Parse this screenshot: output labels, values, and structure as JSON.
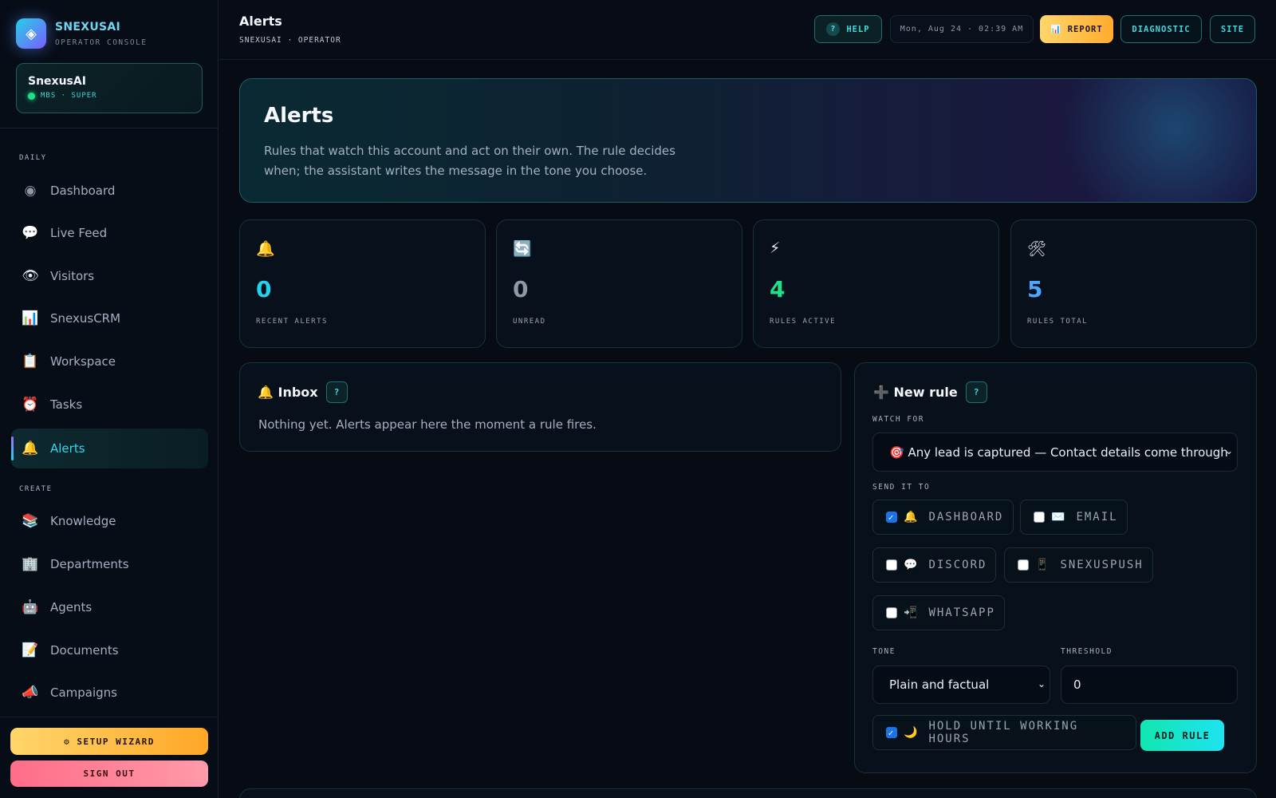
{
  "brand": {
    "name": "SNEXUSAI",
    "subtitle": "OPERATOR CONSOLE",
    "logo_icon": "◈"
  },
  "account": {
    "name": "SnexusAI",
    "plan": "MBS · SUPER",
    "status_color": "#1fe08a"
  },
  "sidebar": {
    "sections": [
      {
        "label": "DAILY"
      },
      {
        "label": "CREATE"
      }
    ],
    "items": [
      {
        "icon": "◉",
        "icon_name": "dashboard-icon",
        "label": "Dashboard"
      },
      {
        "icon": "💬",
        "icon_name": "speech-bubble-icon",
        "label": "Live Feed"
      },
      {
        "icon": "👁",
        "icon_name": "eye-icon",
        "label": "Visitors"
      },
      {
        "icon": "📊",
        "icon_name": "bar-chart-icon",
        "label": "SnexusCRM"
      },
      {
        "icon": "📋",
        "icon_name": "clipboard-icon",
        "label": "Workspace"
      },
      {
        "icon": "⏰",
        "icon_name": "alarm-clock-icon",
        "label": "Tasks"
      },
      {
        "icon": "🔔",
        "icon_name": "bell-icon",
        "label": "Alerts",
        "active": true
      },
      {
        "icon": "📚",
        "icon_name": "books-icon",
        "label": "Knowledge"
      },
      {
        "icon": "🏢",
        "icon_name": "office-building-icon",
        "label": "Departments"
      },
      {
        "icon": "🤖",
        "icon_name": "robot-icon",
        "label": "Agents"
      },
      {
        "icon": "📝",
        "icon_name": "memo-icon",
        "label": "Documents"
      },
      {
        "icon": "📣",
        "icon_name": "megaphone-icon",
        "label": "Campaigns"
      }
    ],
    "setup_wizard": "⚙ SETUP WIZARD",
    "sign_out": "SIGN OUT"
  },
  "topbar": {
    "title": "Alerts",
    "breadcrumb": "SNEXUSAI · OPERATOR",
    "help_label": "HELP",
    "help_icon": "?",
    "clock": "Mon, Aug 24 · 02:39 AM",
    "report_label": "📊 REPORT",
    "diagnostic_label": "DIAGNOSTIC",
    "site_label": "SITE"
  },
  "hero": {
    "title": "Alerts",
    "description": "Rules that watch this account and act on their own. The rule decides when; the assistant writes the message in the tone you choose."
  },
  "stats": [
    {
      "icon": "🔔",
      "icon_name": "bell-icon",
      "value": "0",
      "label": "RECENT ALERTS",
      "color": "#22d3ee"
    },
    {
      "icon": "🔄",
      "icon_name": "refresh-icon",
      "value": "0",
      "label": "UNREAD",
      "color": "#8e99a8"
    },
    {
      "icon": "⚡",
      "icon_name": "lightning-icon",
      "value": "4",
      "label": "RULES ACTIVE",
      "color": "#22e08a"
    },
    {
      "icon": "🛠",
      "icon_name": "tools-icon",
      "value": "5",
      "label": "RULES TOTAL",
      "color": "#4aa8ff"
    }
  ],
  "inbox": {
    "title": "🔔 Inbox",
    "help": "?",
    "empty_text": "Nothing yet. Alerts appear here the moment a rule fires."
  },
  "new_rule": {
    "title": "➕ New rule",
    "help": "?",
    "watch_for_label": "WATCH FOR",
    "watch_for_value": "🎯 Any lead is captured — Contact details come through",
    "send_to_label": "SEND IT TO",
    "channels": [
      {
        "icon": "🔔",
        "label": "DASHBOARD",
        "checked": true
      },
      {
        "icon": "✉️",
        "label": "EMAIL",
        "checked": false
      },
      {
        "icon": "💬",
        "label": "DISCORD",
        "checked": false
      },
      {
        "icon": "📱",
        "label": "SNEXUSPUSH",
        "checked": false
      },
      {
        "icon": "📲",
        "label": "WHATSAPP",
        "checked": false
      }
    ],
    "tone_label": "TONE",
    "tone_value": "Plain and factual",
    "threshold_label": "THRESHOLD",
    "threshold_value": "0",
    "hold_icon": "🌙",
    "hold_label": "HOLD UNTIL WORKING HOURS",
    "hold_checked": true,
    "add_label": "ADD RULE"
  }
}
